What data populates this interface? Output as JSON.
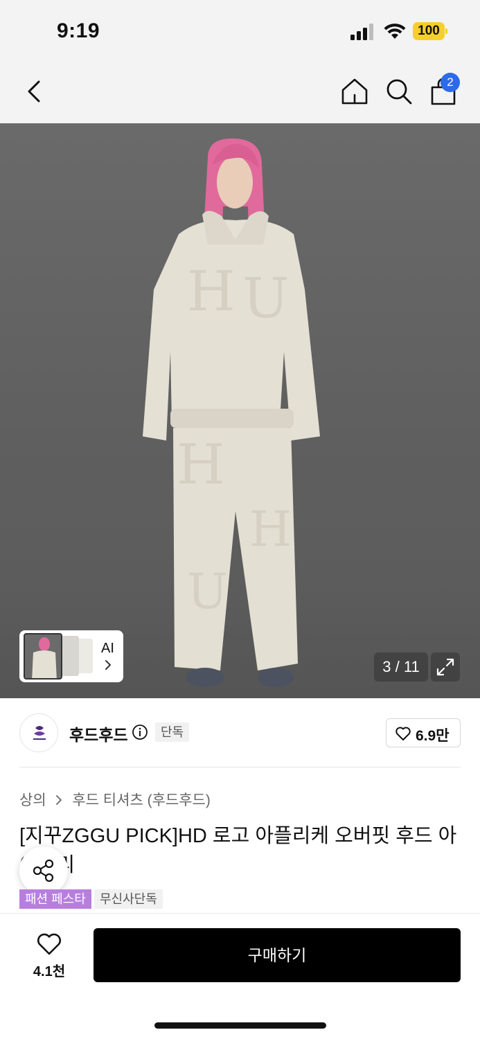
{
  "status_bar": {
    "time": "9:19",
    "battery": "100"
  },
  "nav": {
    "cart_count": "2"
  },
  "gallery": {
    "counter": "3 / 11",
    "ai_label": "AI"
  },
  "brand": {
    "name": "후드후드",
    "exclusive_tag": "단독",
    "likes": "6.9만"
  },
  "breadcrumb": {
    "items": [
      "상의",
      "후드 티셔츠 (후드후드)"
    ]
  },
  "product": {
    "title": "[지꾸ZGGU PICK]HD 로고 아플리케 오버핏 후드 아이보리",
    "tags": [
      "패션 페스타",
      "무신사단독"
    ]
  },
  "bottom_bar": {
    "wish_count": "4.1천",
    "buy_label": "구매하기"
  },
  "colors": {
    "accent_blue": "#2b6be8",
    "festa_purple": "#b77ee0",
    "battery_yellow": "#f5d02a",
    "buy_black": "#000000"
  },
  "icons": [
    "back-icon",
    "home-icon",
    "search-icon",
    "cart-icon",
    "chevron-right-icon",
    "expand-icon",
    "info-icon",
    "heart-icon",
    "share-icon"
  ]
}
